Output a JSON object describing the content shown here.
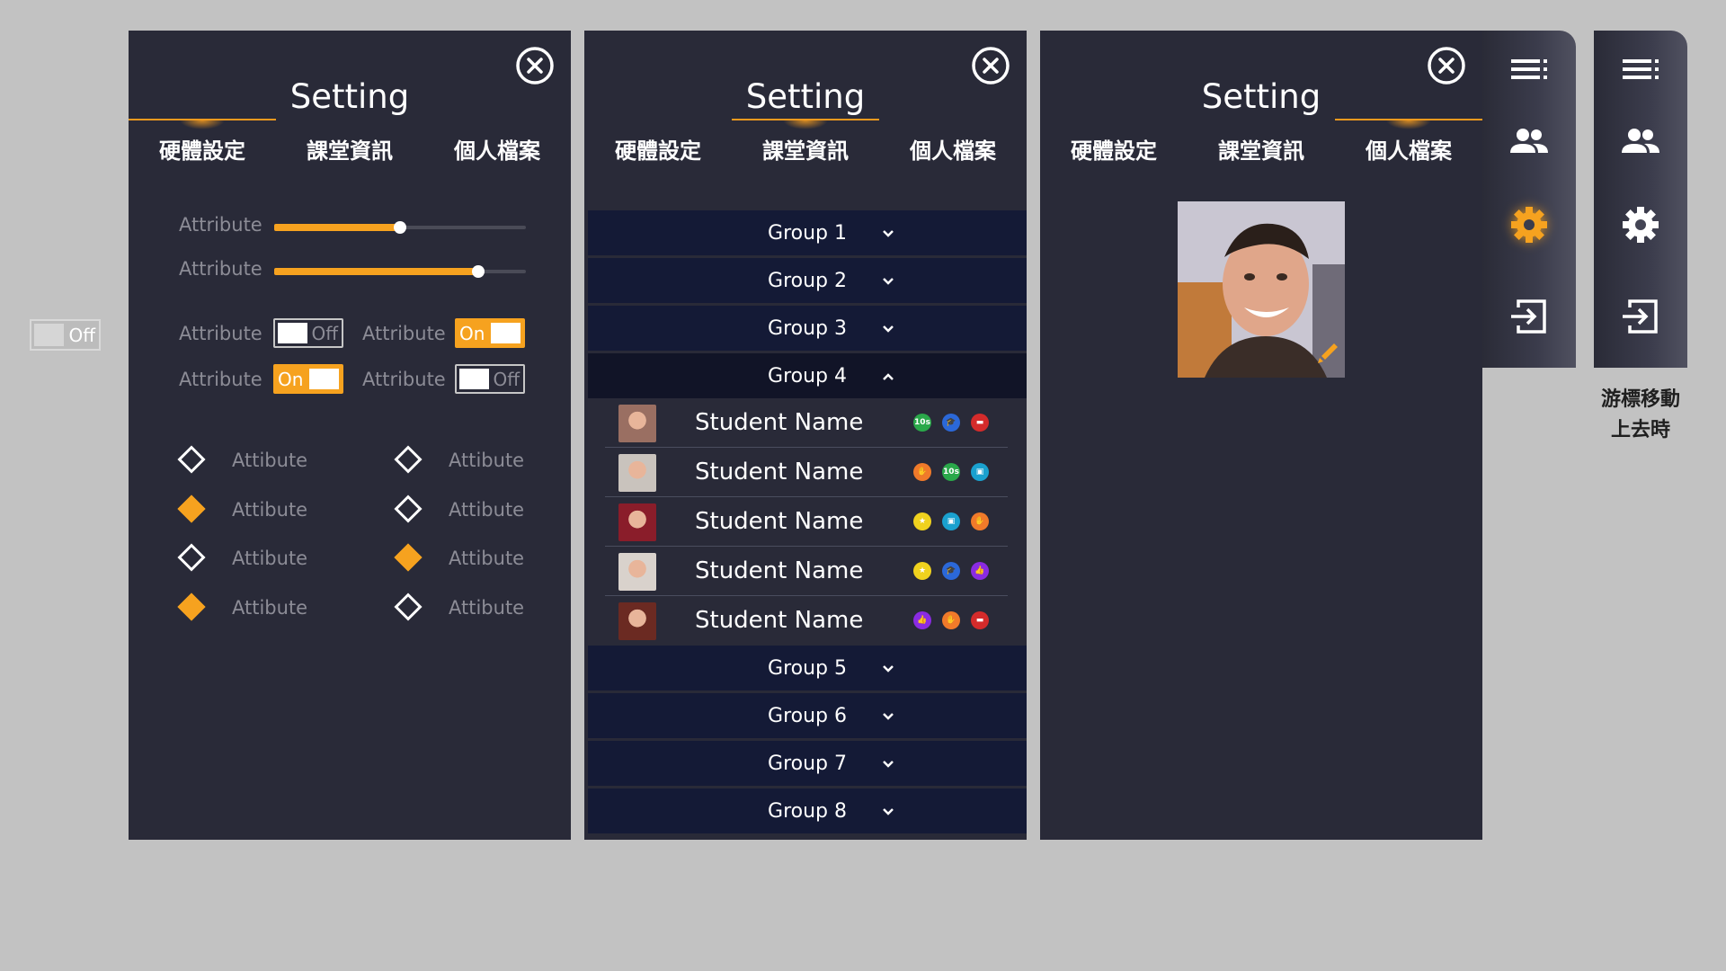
{
  "standalone_toggle": {
    "text": "Off",
    "state": "off"
  },
  "panels": {
    "hardware": {
      "title": "Setting",
      "tabs": [
        {
          "label": "硬體設定",
          "active": true
        },
        {
          "label": "課堂資訊",
          "active": false
        },
        {
          "label": "個人檔案",
          "active": false
        }
      ],
      "sliders": [
        {
          "label": "Attribute",
          "value": 0.5
        },
        {
          "label": "Attribute",
          "value": 0.81
        }
      ],
      "toggles": [
        {
          "label": "Attribute",
          "state": "off",
          "text": "Off"
        },
        {
          "label": "Attribute",
          "state": "on",
          "text": "On"
        },
        {
          "label": "Attribute",
          "state": "on",
          "text": "On"
        },
        {
          "label": "Attribute",
          "state": "off",
          "text": "Off"
        }
      ],
      "radios_left": [
        {
          "label": "Attibute",
          "selected": false
        },
        {
          "label": "Attibute",
          "selected": true
        },
        {
          "label": "Attibute",
          "selected": false
        },
        {
          "label": "Attibute",
          "selected": true
        }
      ],
      "radios_right": [
        {
          "label": "Attibute",
          "selected": false
        },
        {
          "label": "Attibute",
          "selected": false
        },
        {
          "label": "Attibute",
          "selected": true
        },
        {
          "label": "Attibute",
          "selected": false
        }
      ]
    },
    "classroom": {
      "title": "Setting",
      "tabs": [
        {
          "label": "硬體設定",
          "active": false
        },
        {
          "label": "課堂資訊",
          "active": true
        },
        {
          "label": "個人檔案",
          "active": false
        }
      ],
      "groups_top": [
        {
          "label": "Group 1"
        },
        {
          "label": "Group 2"
        },
        {
          "label": "Group 3"
        }
      ],
      "open_group": {
        "label": "Group 4"
      },
      "students": [
        {
          "name": "Student Name",
          "avatar_color": "#9a6f62",
          "badges": [
            {
              "color": "green",
              "text": "10s"
            },
            {
              "color": "blue",
              "text": "🎓"
            },
            {
              "color": "red",
              "text": "▬"
            }
          ]
        },
        {
          "name": "Student Name",
          "avatar_color": "#c9c3bd",
          "badges": [
            {
              "color": "orange",
              "text": "✋"
            },
            {
              "color": "green",
              "text": "10s"
            },
            {
              "color": "teal",
              "text": "▣"
            }
          ]
        },
        {
          "name": "Student Name",
          "avatar_color": "#8a1d2a",
          "badges": [
            {
              "color": "yellow",
              "text": "★"
            },
            {
              "color": "teal",
              "text": "▣"
            },
            {
              "color": "orange",
              "text": "✋"
            }
          ]
        },
        {
          "name": "Student Name",
          "avatar_color": "#d9d2cc",
          "badges": [
            {
              "color": "yellow",
              "text": "★"
            },
            {
              "color": "blue",
              "text": "🎓"
            },
            {
              "color": "purple",
              "text": "👍"
            }
          ]
        },
        {
          "name": "Student Name",
          "avatar_color": "#6b2a22",
          "badges": [
            {
              "color": "purple",
              "text": "👍"
            },
            {
              "color": "orange",
              "text": "✋"
            },
            {
              "color": "red",
              "text": "▬"
            }
          ]
        }
      ],
      "groups_bottom": [
        {
          "label": "Group 5"
        },
        {
          "label": "Group 6"
        },
        {
          "label": "Group 7"
        },
        {
          "label": "Group 8"
        }
      ]
    },
    "profile": {
      "title": "Setting",
      "tabs": [
        {
          "label": "硬體設定",
          "active": false
        },
        {
          "label": "課堂資訊",
          "active": false
        },
        {
          "label": "個人檔案",
          "active": true
        }
      ]
    }
  },
  "sidebars": {
    "active": {
      "items": [
        "menu-icon",
        "people-icon",
        "gear-icon",
        "logout-icon"
      ],
      "active_index": 2
    },
    "hover": {
      "items": [
        "menu-icon",
        "people-icon",
        "gear-icon",
        "logout-icon"
      ],
      "active_index": -1
    },
    "hover_note_line1": "游標移動",
    "hover_note_line2": "上去時"
  },
  "colors": {
    "accent": "#f6a21f",
    "panel_bg": "#292a38",
    "group_bg": "#141a36",
    "page_bg": "#c2c2c2"
  }
}
